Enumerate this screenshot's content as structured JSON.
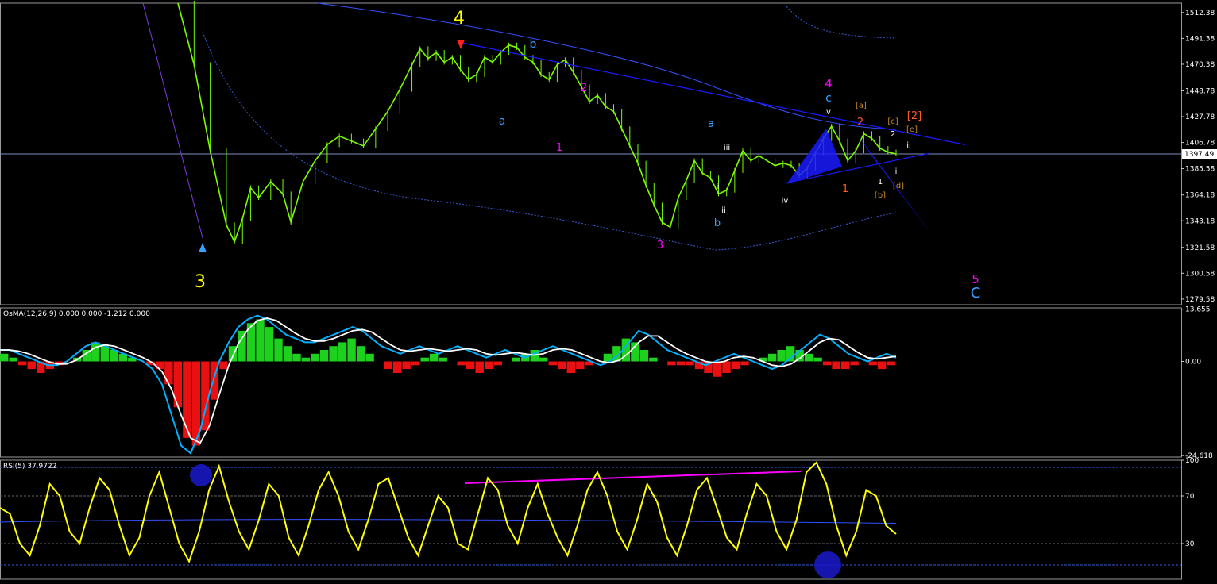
{
  "colors": {
    "background": "#000000",
    "bull_candle": "#7CFC00",
    "grid_line": "#3a3a3a",
    "wave_yellow": "#ffff00",
    "wave_cyan": "#3aa0ff",
    "wave_magenta": "#ff00ff",
    "wave_orange": "#ff5a1f",
    "wave_tan": "#c88a2a",
    "wave_white": "#ffffff",
    "trend_blue": "#1a1aff",
    "histogram_green": "#1fd11f",
    "histogram_red": "#e81010",
    "macd_cyan": "#00b0ff",
    "rsi_yellow": "#ffff00"
  },
  "chart_data": [
    {
      "type": "line",
      "panel": "price",
      "current_price": 1397.49,
      "current_price_label": "1397.49",
      "price_axis_labels": [
        "1512.38",
        "1491.38",
        "1470.38",
        "1448.78",
        "1427.78",
        "1406.78",
        "1385.58",
        "1364.18",
        "1343.18",
        "1321.58",
        "1300.58",
        "1279.58"
      ],
      "price_axis_values": [
        1512.38,
        1491.38,
        1470.38,
        1448.78,
        1427.78,
        1406.78,
        1385.58,
        1364.18,
        1343.18,
        1321.58,
        1300.58,
        1279.58
      ],
      "ylim": [
        1275,
        1520
      ],
      "price_path": [
        [
          0,
          1520
        ],
        [
          4,
          1470
        ],
        [
          8,
          1400
        ],
        [
          12,
          1340
        ],
        [
          14,
          1326
        ],
        [
          16,
          1345
        ],
        [
          18,
          1370
        ],
        [
          20,
          1362
        ],
        [
          23,
          1375
        ],
        [
          26,
          1365
        ],
        [
          28,
          1342
        ],
        [
          31,
          1375
        ],
        [
          34,
          1392
        ],
        [
          37,
          1405
        ],
        [
          40,
          1412
        ],
        [
          43,
          1408
        ],
        [
          46,
          1404
        ],
        [
          49,
          1418
        ],
        [
          52,
          1432
        ],
        [
          55,
          1450
        ],
        [
          58,
          1470
        ],
        [
          60,
          1483
        ],
        [
          62,
          1475
        ],
        [
          64,
          1480
        ],
        [
          66,
          1472
        ],
        [
          68,
          1476
        ],
        [
          70,
          1466
        ],
        [
          72,
          1458
        ],
        [
          74,
          1462
        ],
        [
          76,
          1476
        ],
        [
          78,
          1472
        ],
        [
          80,
          1480
        ],
        [
          82,
          1486
        ],
        [
          84,
          1484
        ],
        [
          86,
          1476
        ],
        [
          88,
          1472
        ],
        [
          90,
          1462
        ],
        [
          92,
          1458
        ],
        [
          94,
          1470
        ],
        [
          96,
          1474
        ],
        [
          98,
          1464
        ],
        [
          100,
          1452
        ],
        [
          102,
          1440
        ],
        [
          104,
          1445
        ],
        [
          106,
          1436
        ],
        [
          108,
          1432
        ],
        [
          110,
          1418
        ],
        [
          112,
          1404
        ],
        [
          114,
          1390
        ],
        [
          116,
          1372
        ],
        [
          118,
          1356
        ],
        [
          120,
          1342
        ],
        [
          122,
          1338
        ],
        [
          124,
          1362
        ],
        [
          126,
          1376
        ],
        [
          128,
          1392
        ],
        [
          130,
          1382
        ],
        [
          132,
          1378
        ],
        [
          134,
          1365
        ],
        [
          136,
          1368
        ],
        [
          138,
          1384
        ],
        [
          140,
          1400
        ],
        [
          142,
          1392
        ],
        [
          144,
          1396
        ],
        [
          146,
          1392
        ],
        [
          148,
          1388
        ],
        [
          150,
          1390
        ],
        [
          152,
          1388
        ],
        [
          154,
          1380
        ],
        [
          156,
          1386
        ],
        [
          158,
          1398
        ],
        [
          160,
          1410
        ],
        [
          162,
          1420
        ],
        [
          164,
          1408
        ],
        [
          166,
          1392
        ],
        [
          168,
          1400
        ],
        [
          170,
          1414
        ],
        [
          172,
          1410
        ],
        [
          174,
          1402
        ],
        [
          176,
          1399
        ],
        [
          178,
          1397.49
        ]
      ],
      "wave_labels": [
        {
          "text": "4",
          "color": "#ffff00",
          "size": "large"
        },
        {
          "text": "3",
          "color": "#ffff00",
          "size": "large"
        },
        {
          "text": "a",
          "color": "#3aa0ff"
        },
        {
          "text": "b",
          "color": "#3aa0ff"
        },
        {
          "text": "1",
          "color": "#ff00ff"
        },
        {
          "text": "2",
          "color": "#ff00ff"
        },
        {
          "text": "3",
          "color": "#ff00ff"
        },
        {
          "text": "a",
          "color": "#3aa0ff"
        },
        {
          "text": "b",
          "color": "#3aa0ff"
        },
        {
          "text": "i",
          "color": "#ffffff"
        },
        {
          "text": "ii",
          "color": "#ffffff"
        },
        {
          "text": "iii",
          "color": "#ffffff"
        },
        {
          "text": "iv",
          "color": "#ffffff"
        },
        {
          "text": "v",
          "color": "#ffffff"
        },
        {
          "text": "4",
          "color": "#ff00ff"
        },
        {
          "text": "c",
          "color": "#3aa0ff"
        },
        {
          "text": "[a]",
          "color": "#c88a2a"
        },
        {
          "text": "2",
          "color": "#ff5a1f"
        },
        {
          "text": "1",
          "color": "#ff5a1f"
        },
        {
          "text": "[c]",
          "color": "#c88a2a"
        },
        {
          "text": "[e]",
          "color": "#c88a2a"
        },
        {
          "text": "[2]",
          "color": "#ff5a1f"
        },
        {
          "text": "2",
          "color": "#ffffff"
        },
        {
          "text": "ii",
          "color": "#ffffff"
        },
        {
          "text": "i",
          "color": "#ffffff"
        },
        {
          "text": "1",
          "color": "#ffffff"
        },
        {
          "text": "[b]",
          "color": "#c88a2a"
        },
        {
          "text": "[d]",
          "color": "#c88a2a"
        },
        {
          "text": "5",
          "color": "#ff00ff"
        },
        {
          "text": "C",
          "color": "#3aa0ff"
        }
      ]
    },
    {
      "type": "bar",
      "panel": "oscillator",
      "title": "OsMA(12,26,9) 0.000 0.000 -1.212 0.000",
      "axis_labels": [
        "13.655",
        "0.00",
        "-24.618"
      ],
      "axis_values": [
        13.655,
        0,
        -24.618
      ],
      "ylim": [
        -25,
        14
      ],
      "histogram": [
        2,
        1,
        -1,
        -2,
        -3,
        -2,
        -1,
        0,
        1,
        3,
        5,
        4,
        3,
        2,
        1,
        0,
        -1,
        -2,
        -6,
        -12,
        -20,
        -22,
        -18,
        -10,
        -2,
        4,
        8,
        10,
        11,
        9,
        6,
        4,
        2,
        1,
        2,
        3,
        4,
        5,
        6,
        4,
        2,
        0,
        -2,
        -3,
        -2,
        -1,
        1,
        2,
        1,
        0,
        -1,
        -2,
        -3,
        -2,
        -1,
        0,
        1,
        2,
        3,
        1,
        -1,
        -2,
        -3,
        -2,
        -1,
        0,
        2,
        4,
        6,
        5,
        3,
        1,
        0,
        -1,
        -1,
        -1,
        -2,
        -3,
        -4,
        -3,
        -2,
        -1,
        0,
        1,
        2,
        3,
        4,
        3,
        2,
        1,
        -1,
        -2,
        -2,
        -1,
        0,
        -1,
        -2,
        -1
      ],
      "macd_line": [
        3,
        3,
        2,
        1,
        0,
        -1,
        -1,
        0,
        2,
        4,
        5,
        4,
        3,
        2,
        1,
        0,
        -2,
        -6,
        -14,
        -22,
        -24,
        -18,
        -8,
        0,
        5,
        9,
        11,
        12,
        11,
        9,
        7,
        6,
        5,
        5,
        6,
        7,
        8,
        9,
        8,
        6,
        4,
        3,
        2,
        3,
        4,
        3,
        2,
        3,
        4,
        3,
        2,
        1,
        2,
        3,
        2,
        1,
        2,
        3,
        4,
        3,
        2,
        1,
        0,
        -1,
        0,
        2,
        5,
        8,
        7,
        5,
        3,
        2,
        1,
        0,
        -1,
        0,
        1,
        2,
        1,
        0,
        -1,
        -2,
        -1,
        1,
        3,
        5,
        7,
        6,
        4,
        2,
        1,
        0,
        1,
        2,
        1
      ]
    },
    {
      "type": "line",
      "panel": "rsi",
      "title": "RSI(5) 37.9722",
      "axis_labels": [
        "100",
        "70",
        "30"
      ],
      "axis_values": [
        100,
        70,
        30
      ],
      "ylim": [
        0,
        100
      ],
      "rsi_values": [
        60,
        55,
        30,
        20,
        45,
        80,
        70,
        40,
        30,
        60,
        85,
        75,
        45,
        20,
        35,
        70,
        90,
        60,
        30,
        15,
        40,
        75,
        95,
        65,
        40,
        25,
        50,
        80,
        70,
        35,
        20,
        45,
        75,
        90,
        70,
        40,
        25,
        50,
        80,
        85,
        60,
        35,
        20,
        45,
        70,
        60,
        30,
        25,
        55,
        85,
        75,
        45,
        30,
        60,
        80,
        55,
        35,
        20,
        45,
        75,
        90,
        70,
        40,
        25,
        50,
        80,
        65,
        35,
        20,
        45,
        75,
        85,
        60,
        35,
        25,
        55,
        80,
        70,
        40,
        25,
        50,
        90,
        98,
        80,
        45,
        20,
        40,
        75,
        70,
        45,
        38
      ]
    }
  ]
}
